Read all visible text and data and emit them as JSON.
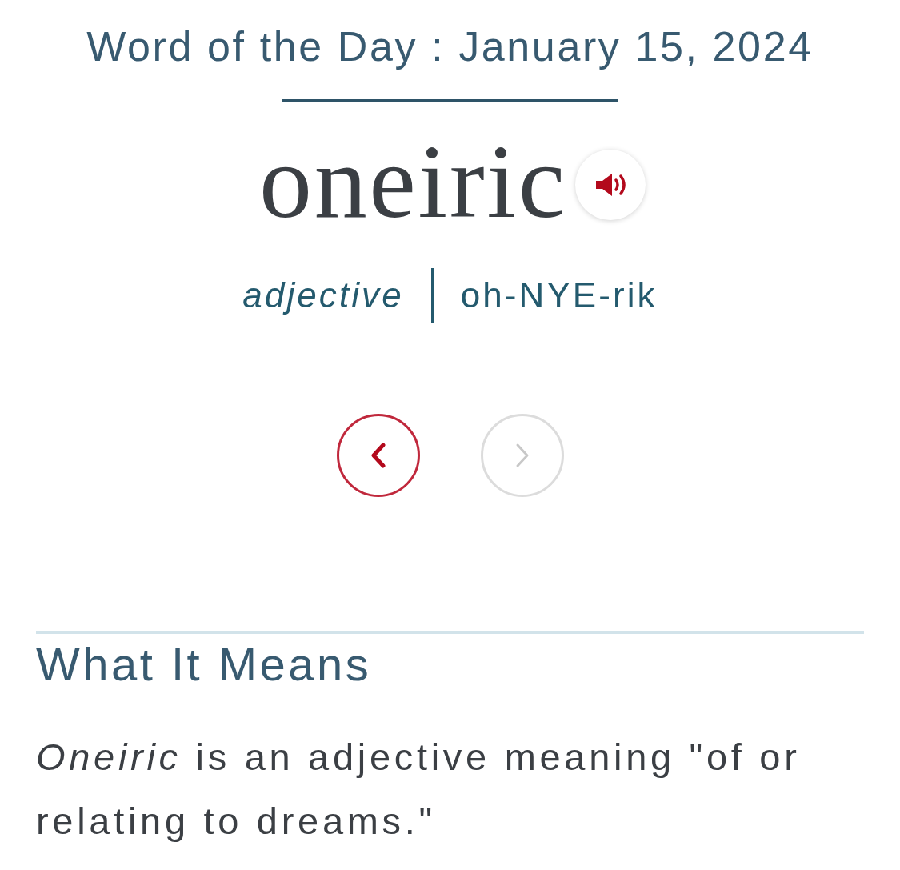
{
  "header": {
    "title": "Word of the Day : January 15, 2024"
  },
  "word": {
    "text": "oneiric",
    "part_of_speech": "adjective",
    "pronunciation": "oh-NYE-rik"
  },
  "nav": [
    {
      "kind": "prev",
      "disabled": false
    },
    {
      "kind": "next",
      "disabled": true
    }
  ],
  "section": {
    "heading": "What It Means",
    "body": "*Oneiric* is an adjective meaning \"of or relating to dreams.\""
  }
}
